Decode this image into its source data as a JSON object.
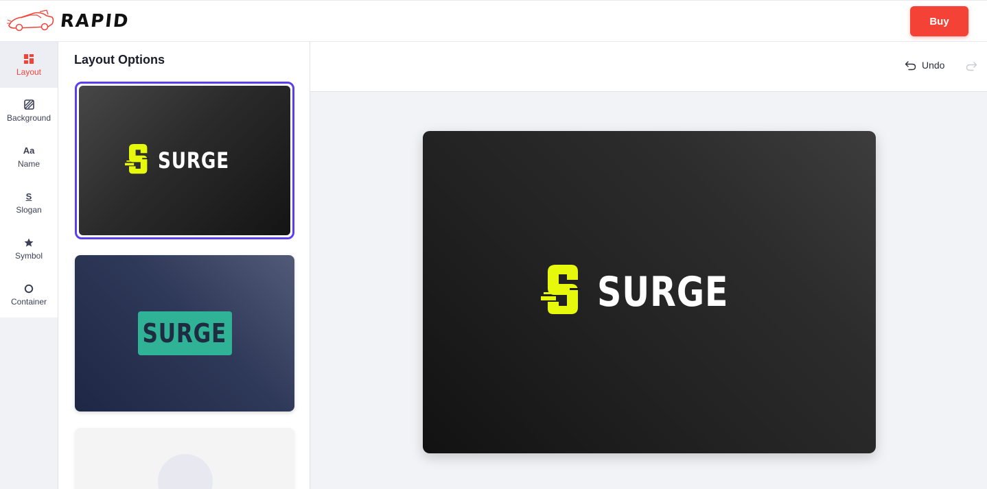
{
  "app": {
    "name": "RAPID"
  },
  "header": {
    "buy_label": "Buy"
  },
  "rail": {
    "items": [
      {
        "label": "Layout",
        "icon": "layout-icon",
        "active": true
      },
      {
        "label": "Background",
        "icon": "background-icon"
      },
      {
        "label": "Name",
        "icon": "name-icon"
      },
      {
        "label": "Slogan",
        "icon": "slogan-icon"
      },
      {
        "label": "Symbol",
        "icon": "star-icon"
      },
      {
        "label": "Container",
        "icon": "circle-icon"
      }
    ]
  },
  "options": {
    "title": "Layout Options",
    "cards": [
      {
        "brand": "SURGE",
        "style": "dark",
        "selected": true
      },
      {
        "brand": "SURGE",
        "style": "navy-badge"
      },
      {
        "brand": "",
        "style": "light"
      }
    ]
  },
  "toolbar": {
    "undo_label": "Undo"
  },
  "preview": {
    "brand": "SURGE"
  },
  "colors": {
    "accent": "#f44336",
    "selection": "#5a3ff0",
    "symbol": "#e6f90c",
    "badge": "#2fb296"
  }
}
